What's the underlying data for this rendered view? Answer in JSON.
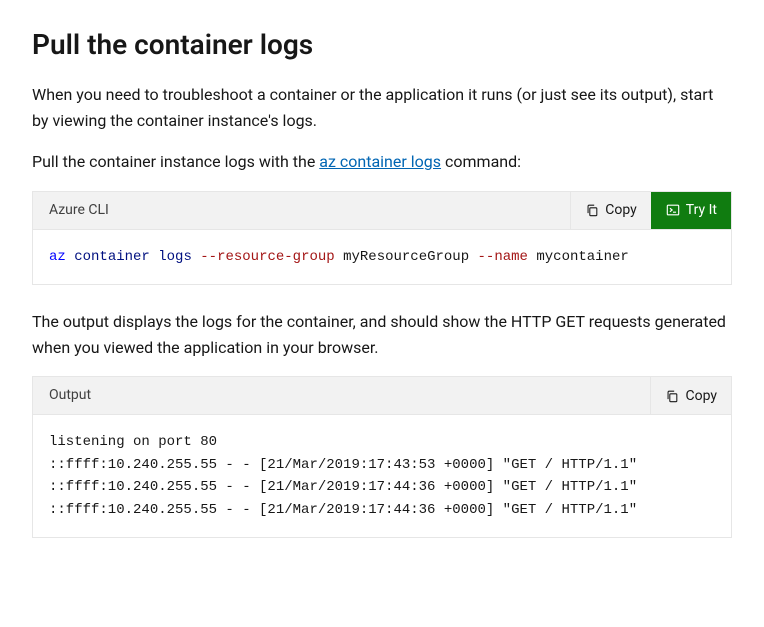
{
  "heading": "Pull the container logs",
  "para1": "When you need to troubleshoot a container or the application it runs (or just see its output), start by viewing the container instance's logs.",
  "para2_a": "Pull the container instance logs with the ",
  "para2_link": "az container logs",
  "para2_b": " command:",
  "block1": {
    "lang": "Azure CLI",
    "copy": "Copy",
    "tryit": "Try It",
    "cmd": "az",
    "sub1": "container",
    "sub2": "logs",
    "arg1": "--resource-group",
    "val1": "myResourceGroup",
    "arg2": "--name",
    "val2": "mycontainer"
  },
  "para3": "The output displays the logs for the container, and should show the HTTP GET requests generated when you viewed the application in your browser.",
  "block2": {
    "lang": "Output",
    "copy": "Copy",
    "content": "listening on port 80\n::ffff:10.240.255.55 - - [21/Mar/2019:17:43:53 +0000] \"GET / HTTP/1.1\" \n::ffff:10.240.255.55 - - [21/Mar/2019:17:44:36 +0000] \"GET / HTTP/1.1\" \n::ffff:10.240.255.55 - - [21/Mar/2019:17:44:36 +0000] \"GET / HTTP/1.1\" "
  }
}
